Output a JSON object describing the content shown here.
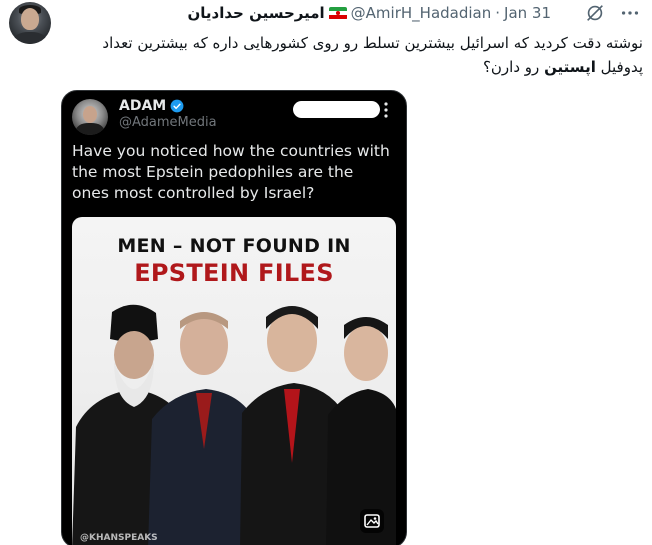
{
  "author": {
    "display_name": "امیرحسین حدادیان",
    "handle": "@AmirH_Hadadian",
    "separator": "·",
    "date": "Jan 31",
    "flag_icon": "iran-flag-icon"
  },
  "tweet": {
    "line1": "نوشته دقت کردید که اسرائیل بیشترین تسلط رو روی کشورهایی داره که بیشترین تعداد",
    "line2_prefix": "پدوفیل",
    "line2_bold": "اپستین",
    "line2_suffix": "رو دارن؟"
  },
  "quoted": {
    "name": "ADAM",
    "handle": "@AdameMedia",
    "text": "Have you noticed how the countries with the most Epstein pedophiles are the ones most controlled by Israel?",
    "verified_color": "#1d9bf0"
  },
  "poster": {
    "title_line1": "MEN – NOT FOUND IN",
    "title_line2": "EPSTEIN FILES",
    "watermark": "@KHANSPEAKS",
    "accent": "#b0181b"
  },
  "icons": {
    "grok": "grok-icon",
    "more": "more-icon",
    "alt": "alt-text-icon"
  }
}
